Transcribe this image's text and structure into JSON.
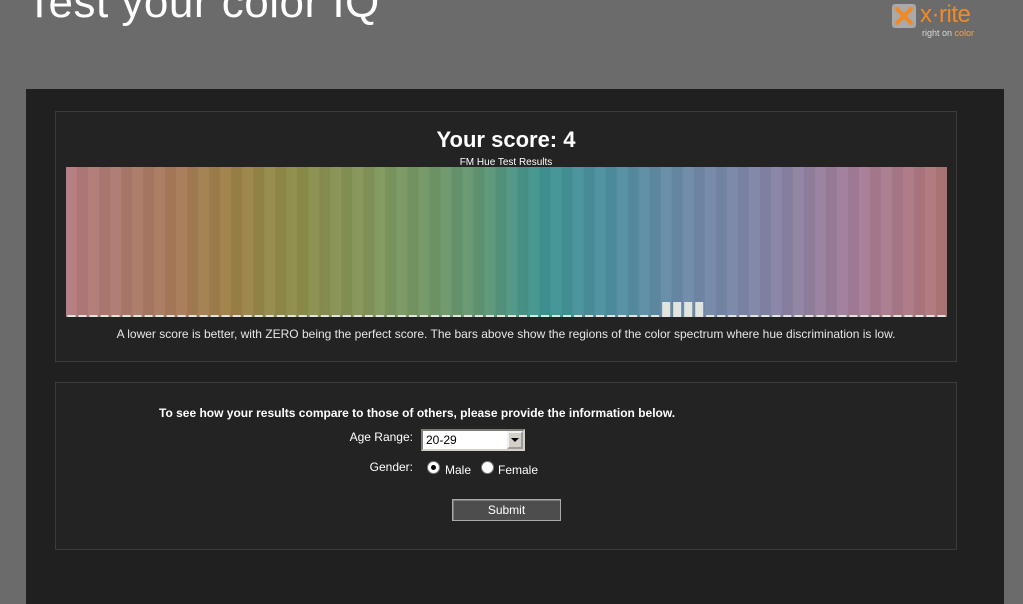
{
  "page": {
    "title": "Test your color IQ"
  },
  "logo": {
    "brand": "x·rite",
    "tagline_prefix": "right on ",
    "tagline_highlight": "color",
    "colors": {
      "brand": "#f28a24",
      "mark": "#a9a9a9"
    }
  },
  "results": {
    "score_label": "Your score: 4",
    "note": "A lower score is better, with ZERO being the perfect score. The bars above show the regions of the color spectrum where hue discrimination is low."
  },
  "chart_data": {
    "type": "bar",
    "title": "FM Hue Test Results",
    "bin_count": 80,
    "values": [
      0,
      0,
      0,
      0,
      0,
      0,
      0,
      0,
      0,
      0,
      0,
      0,
      0,
      0,
      0,
      0,
      0,
      0,
      0,
      0,
      0,
      0,
      0,
      0,
      0,
      0,
      0,
      0,
      0,
      0,
      0,
      0,
      0,
      0,
      0,
      0,
      0,
      0,
      0,
      0,
      0,
      0,
      0,
      0,
      0,
      0,
      0,
      0,
      0,
      0,
      0,
      0,
      0,
      0,
      1,
      1,
      1,
      1,
      0,
      0,
      0,
      0,
      0,
      0,
      0,
      0,
      0,
      0,
      0,
      0,
      0,
      0,
      0,
      0,
      0,
      0,
      0,
      0,
      0,
      0
    ],
    "ylim": [
      0,
      10
    ],
    "bar_color": "#e2e5dd",
    "spectrum_stops": [
      {
        "offset": 0.0,
        "color": "#b47b80"
      },
      {
        "offset": 0.1,
        "color": "#aa7a62"
      },
      {
        "offset": 0.18,
        "color": "#a08048"
      },
      {
        "offset": 0.26,
        "color": "#8e8d49"
      },
      {
        "offset": 0.36,
        "color": "#80985e"
      },
      {
        "offset": 0.46,
        "color": "#65976f"
      },
      {
        "offset": 0.54,
        "color": "#3f9592"
      },
      {
        "offset": 0.62,
        "color": "#4f8fa0"
      },
      {
        "offset": 0.7,
        "color": "#6b8aa8"
      },
      {
        "offset": 0.8,
        "color": "#8584a6"
      },
      {
        "offset": 0.9,
        "color": "#a67d98"
      },
      {
        "offset": 1.0,
        "color": "#b27676"
      }
    ]
  },
  "compare_form": {
    "intro": "To see how your results compare to those of others, please provide the information below.",
    "age_label": "Age Range:",
    "age_value": "20-29",
    "gender_label": "Gender:",
    "gender_options": [
      "Male",
      "Female"
    ],
    "gender_selected": "Male",
    "submit_label": "Submit"
  }
}
